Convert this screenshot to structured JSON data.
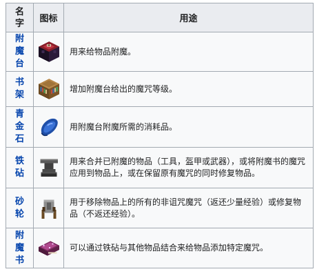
{
  "table": {
    "headers": {
      "name": "名字",
      "icon": "图标",
      "use": "用途"
    },
    "rows": [
      {
        "name": "附魔台",
        "icon": "enchanting-table-icon",
        "use": "用来给物品附魔。"
      },
      {
        "name": "书架",
        "icon": "bookshelf-icon",
        "use": "增加附魔台给出的魔咒等级。"
      },
      {
        "name": "青金石",
        "icon": "lapis-lazuli-icon",
        "use": "用附魔台附魔所需的消耗品。"
      },
      {
        "name": "铁砧",
        "icon": "anvil-icon",
        "use": "用来合并已附魔的物品（工具，盔甲或武器），或将附魔书的魔咒应用到物品上，或在保留原有魔咒的同时修复物品。"
      },
      {
        "name": "砂轮",
        "icon": "grindstone-icon",
        "use": "用于移除物品上的所有的非诅咒魔咒（返还少量经验）或修复物品（不返还经验）。"
      },
      {
        "name": "附魔书",
        "icon": "enchanted-book-icon",
        "use": "可以通过铁砧与其他物品结合来给物品添加特定魔咒。"
      }
    ]
  },
  "colors": {
    "link": "#0645ad",
    "header_bg": "#eaecf0",
    "cell_bg": "#f8f9fa",
    "border": "#a2a9b1"
  }
}
